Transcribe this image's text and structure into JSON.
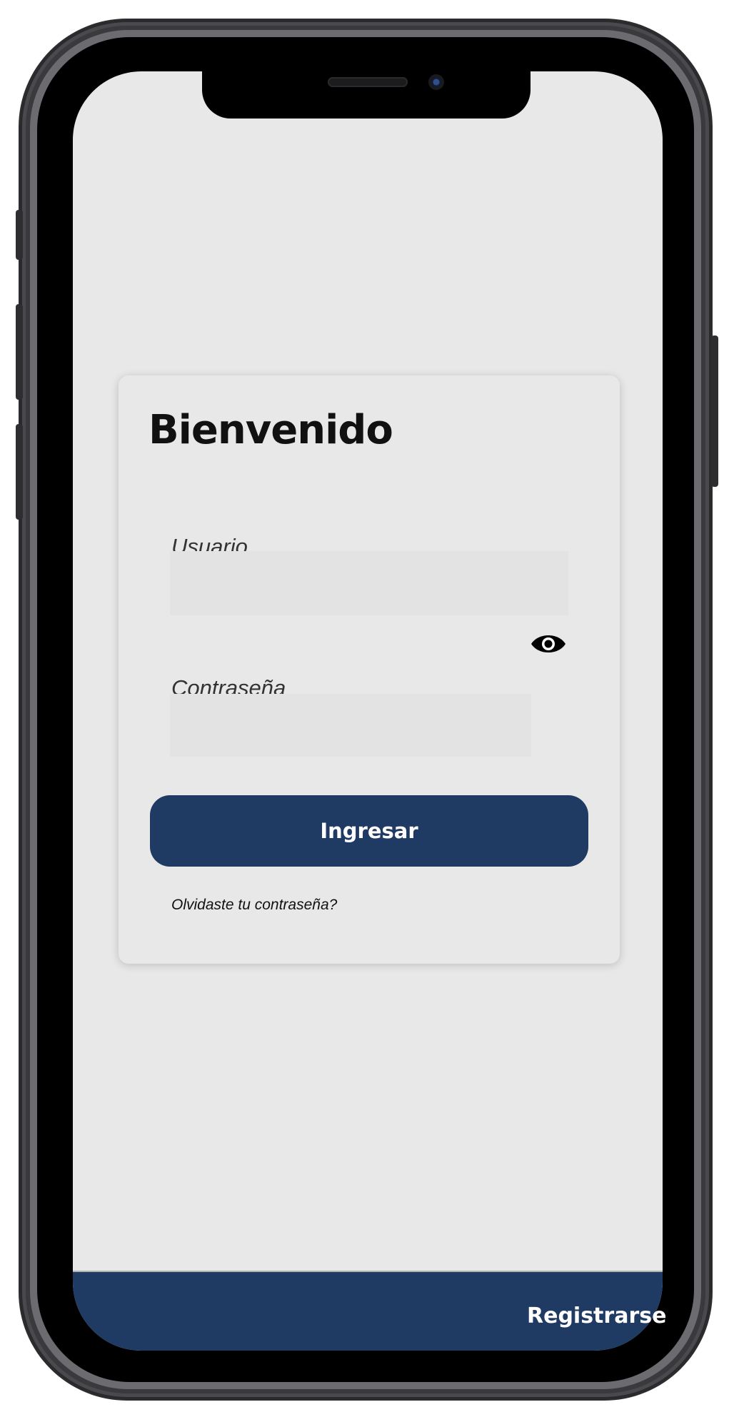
{
  "login": {
    "title": "Bienvenido",
    "username_label": "Usuario",
    "username_value": "",
    "password_label": "Contraseña",
    "password_value": "",
    "submit_label": "Ingresar",
    "forgot_label": "Olvidaste tu contraseña?"
  },
  "bottom_bar": {
    "register_label": "Registrarse"
  },
  "icons": {
    "password_toggle": "eye-icon"
  },
  "colors": {
    "primary": "#1f3a63",
    "background": "#e8e8e8",
    "input_background": "#e3e3e3"
  }
}
